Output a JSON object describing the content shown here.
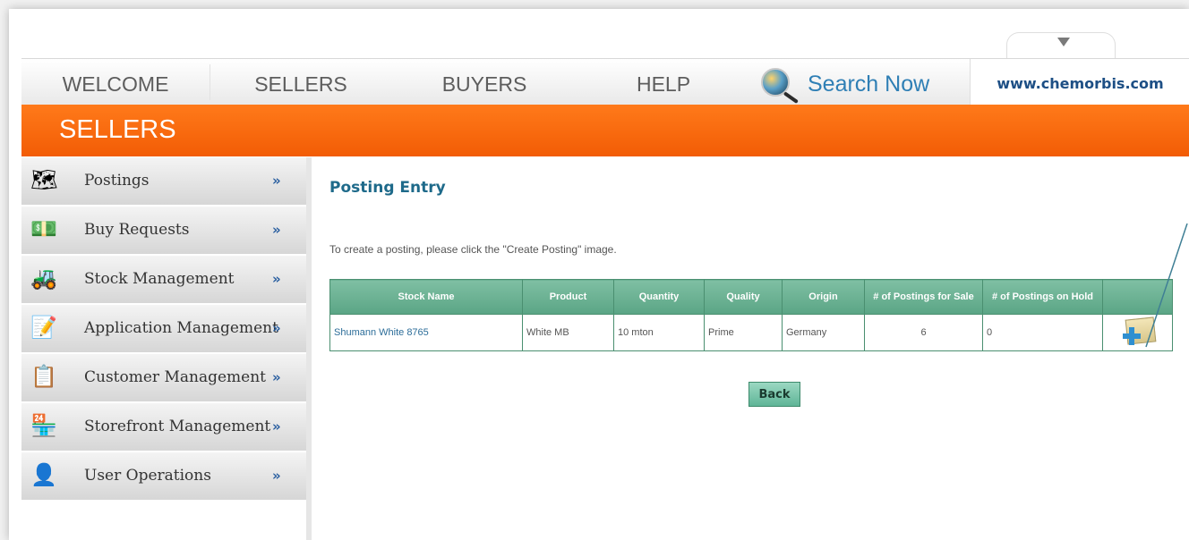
{
  "topnav": {
    "items": [
      "WELCOME",
      "SELLERS",
      "BUYERS",
      "HELP"
    ],
    "search_label": "Search Now",
    "site_url": "www.chemorbis.com"
  },
  "section": {
    "title": "SELLERS"
  },
  "sidebar": {
    "items": [
      {
        "label": "Postings",
        "icon": "map-icon",
        "arrow": "»"
      },
      {
        "label": "Buy Requests",
        "icon": "cash-icon",
        "arrow": "»"
      },
      {
        "label": "Stock Management",
        "icon": "forklift-icon",
        "arrow": "»"
      },
      {
        "label": "Application Management",
        "icon": "application-icon",
        "arrow": "»"
      },
      {
        "label": "Customer Management",
        "icon": "checklist-user-icon",
        "arrow": "»"
      },
      {
        "label": "Storefront Management",
        "icon": "storefront-icon",
        "arrow": "»"
      },
      {
        "label": "User Operations",
        "icon": "user-icon",
        "arrow": "»"
      }
    ]
  },
  "main": {
    "title": "Posting Entry",
    "instruction": "To create a posting, please click the \"Create Posting\" image.",
    "table": {
      "headers": [
        "Stock Name",
        "Product",
        "Quantity",
        "Quality",
        "Origin",
        "# of Postings for Sale",
        "# of Postings on Hold",
        ""
      ],
      "rows": [
        [
          "Shumann White 8765",
          "White MB",
          "10 mton",
          "Prime",
          "Germany",
          "6",
          "0",
          ""
        ]
      ]
    },
    "back_label": "Back"
  },
  "colors": {
    "banner": "#f25c05",
    "table_header": "#5aa585",
    "link": "#2c6d99",
    "title": "#1e6a8a"
  }
}
